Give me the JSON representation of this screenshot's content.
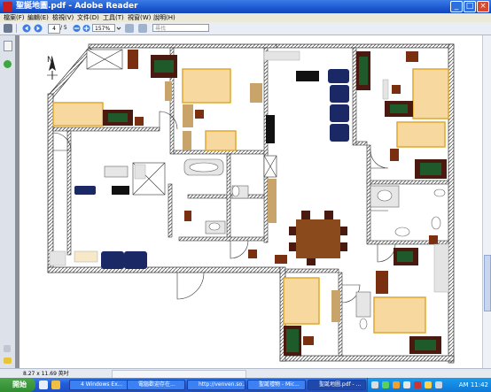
{
  "window": {
    "title": "聖誕地圖.pdf - Adobe Reader",
    "minimize_glyph": "_",
    "maximize_glyph": "□",
    "close_glyph": "×"
  },
  "menu": [
    {
      "label": "檔案(F)"
    },
    {
      "label": "編輯(E)"
    },
    {
      "label": "檢視(V)"
    },
    {
      "label": "文件(D)"
    },
    {
      "label": "工具(T)"
    },
    {
      "label": "視窗(W)"
    },
    {
      "label": "說明(H)"
    }
  ],
  "toolbar": {
    "page_current": "4",
    "page_total": "/ 5",
    "zoom": "157%",
    "search_placeholder": "尋找"
  },
  "status": {
    "page_size": "8.27 x 11.69 英吋"
  },
  "plan": {
    "compass_letter": "N"
  },
  "taskbar": {
    "start_label": "開始",
    "tasks": [
      {
        "label": "4 Windows Ex..."
      },
      {
        "label": "電腦歡迎存在..."
      },
      {
        "label": "http://venven.so..."
      },
      {
        "label": "聖誕禮物 - Mic..."
      },
      {
        "label": "聖誕地圖.pdf - ..."
      }
    ],
    "clock": "AM 11:42"
  },
  "colors": {
    "title_blue": "#1c58d0",
    "taskbar_blue": "#245edb",
    "start_green": "#3a9a3a",
    "bed_fill": "#f7d9a0",
    "bed_border": "#e0a830",
    "table_brown": "#8a4a1c",
    "sofa_navy": "#1a2866",
    "dark_wood": "#4a1a10",
    "desk_green": "#1f5a2a"
  }
}
